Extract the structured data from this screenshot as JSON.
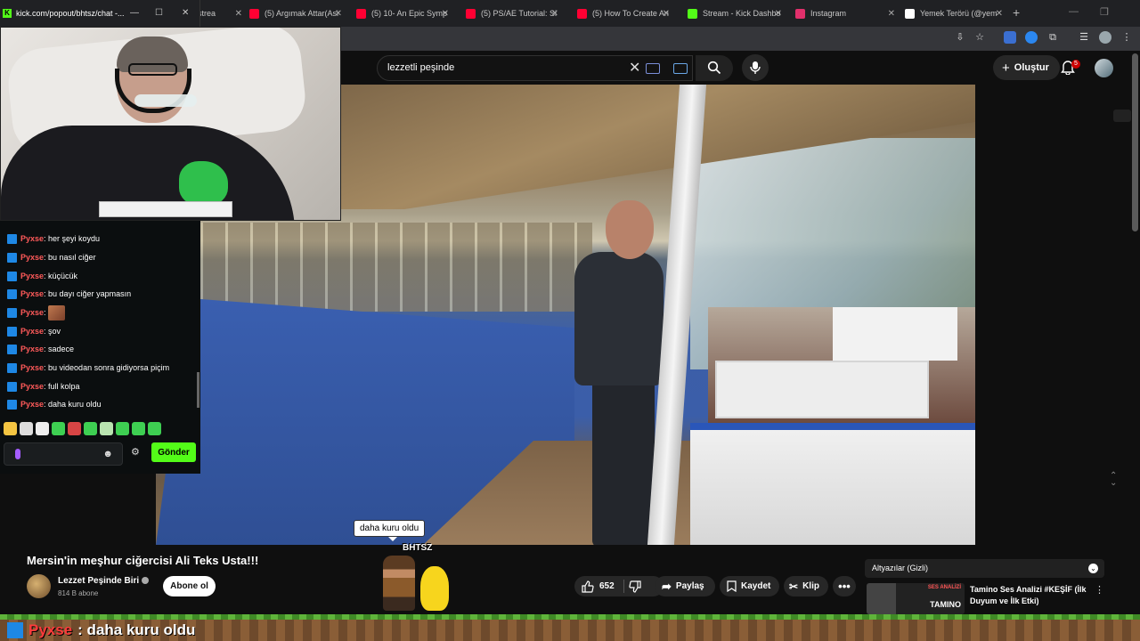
{
  "browser": {
    "tabs": [
      {
        "label": "strea",
        "icon": "generic-tab-icon",
        "color": "#888888"
      },
      {
        "label": "(5) Argımak Attar(Asi",
        "icon": "youtube-icon",
        "color": "#ff0033"
      },
      {
        "label": "(5) 10- An Epic Symp",
        "icon": "youtube-icon",
        "color": "#ff0033"
      },
      {
        "label": "(5) PS/AE Tutorial: Si",
        "icon": "youtube-icon",
        "color": "#ff0033"
      },
      {
        "label": "(5) How To Create An",
        "icon": "youtube-icon",
        "color": "#ff0033"
      },
      {
        "label": "Stream - Kick Dashbo",
        "icon": "kick-icon",
        "color": "#53fc18"
      },
      {
        "label": "Instagram",
        "icon": "instagram-icon",
        "color": "#e1306c"
      },
      {
        "label": "Yemek Terörü (@yem",
        "icon": "x-icon",
        "color": "#ffffff"
      }
    ]
  },
  "popup": {
    "url": "kick.com/popout/bhtsz/chat -..."
  },
  "youtube": {
    "search_value": "lezzetli peşinde",
    "create_label": "Oluştur",
    "notifications": "5"
  },
  "chat": {
    "messages": [
      {
        "user": "Pyxse",
        "text": ": her şeyi koydu"
      },
      {
        "user": "Pyxse",
        "text": ": bu nasıl ciğer"
      },
      {
        "user": "Pyxse",
        "text": ": küçücük"
      },
      {
        "user": "Pyxse",
        "text": ": bu dayı ciğer yapmasın"
      },
      {
        "user": "Pyxse",
        "text": ":",
        "emote": true
      },
      {
        "user": "Pyxse",
        "text": ": şov"
      },
      {
        "user": "Pyxse",
        "text": ": sadece"
      },
      {
        "user": "Pyxse",
        "text": ": bu videodan sonra gidiyorsa piçim"
      },
      {
        "user": "Pyxse",
        "text": ": full kolpa"
      },
      {
        "user": "Pyxse",
        "text": ": daha kuru oldu"
      }
    ],
    "send_label": "Gönder",
    "emote_colors": [
      "#f5c542",
      "#dddddd",
      "#eeeeee",
      "#3ecf52",
      "#d84545",
      "#3ecf52",
      "#b9e4b0",
      "#3ecf52",
      "#3ecf52",
      "#3ecf52"
    ]
  },
  "overlay": {
    "bubble_text": "daha kuru oldu",
    "streamer_name": "BHTSZ"
  },
  "video": {
    "title": "Mersin'in meşhur ciğercisi Ali Teks Usta!!!",
    "channel": "Lezzet Peşinde Biri",
    "subscribers": "814 B abone",
    "subscribe_label": "Abone ol",
    "likes": "652",
    "share_label": "Paylaş",
    "save_label": "Kaydet",
    "clip_label": "Klip"
  },
  "sidebar": {
    "subtitle_chip": "Altyazılar (Gizli)",
    "recommended": {
      "title": "Tamino Ses Analizi #KEŞİF (İlk Duyum ve İlk Etki)",
      "thumb_tag": "SES ANALİZİ",
      "thumb_brand": "TAMINO"
    }
  },
  "ticker": {
    "user": "Pyxse",
    "text": ": daha kuru oldu"
  }
}
